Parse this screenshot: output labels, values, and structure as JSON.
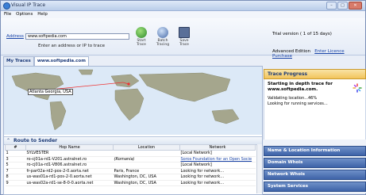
{
  "window": {
    "title": "Visual IP Trace"
  },
  "menu": [
    "File",
    "Options",
    "Help"
  ],
  "address": {
    "label": "Address",
    "value": "www.softpedia.com",
    "hint": "Enter an address or IP to trace"
  },
  "toolbar": {
    "start_label": "Start\nTrace",
    "batch_label": "Batch\nTracing",
    "save_label": "Save\nTrace"
  },
  "trial": {
    "text": "Trial version ( 1 of 15 days)",
    "edition": "Advanced Edition",
    "enter_licence": "Enter Licence",
    "purchase": "Purchase"
  },
  "tabs": [
    "My Traces",
    "www.softpedia.com"
  ],
  "map": {
    "marker_label": "Atlanta Georgia, USA"
  },
  "route": {
    "title": "Route to Sender",
    "columns": [
      "#",
      "Hop Name",
      "Location",
      "Network"
    ],
    "rows": [
      {
        "num": "1",
        "hop": "SYLVESTER",
        "location": "",
        "network": "[Local Network]"
      },
      {
        "num": "3",
        "hop": "ro-cj01a-rd1-V201.astralnet.ro",
        "location": "(Romania)",
        "network": "Soros Foundation for an Open Socie"
      },
      {
        "num": "5",
        "hop": "ro-cj01a-rd1-V806.astralnet.ro",
        "location": "",
        "network": "[Local Network]"
      },
      {
        "num": "7",
        "hop": "fr-par02a-rd2-pos-2-0.aorta.net",
        "location": "Paris, France",
        "network": "Looking for network..."
      },
      {
        "num": "8",
        "hop": "us-was01a-rd1-pos-2-0.aorta.net",
        "location": "Washington, DC, USA",
        "network": "Looking for network..."
      },
      {
        "num": "9",
        "hop": "us-was02a-rd1-se-8-0-0.aorta.net",
        "location": "Washington, DC, USA",
        "network": "Looking for network..."
      }
    ]
  },
  "trace_progress": {
    "title": "Trace Progress",
    "heading": "Starting in depth trace for www.softpedia.com.",
    "validating": "Validating location...46%",
    "looking": "Looking for running services..."
  },
  "side_panels": [
    "Name & Location Information",
    "Domain Whois",
    "Network Whois",
    "System Services"
  ],
  "colors": {
    "accent": "#3e63a8",
    "progress_header": "#f2c45b",
    "link": "#1b45a8"
  }
}
